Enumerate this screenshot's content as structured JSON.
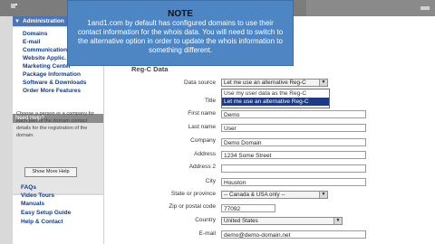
{
  "sidebar": {
    "section_title": "Administration",
    "items": [
      "Domains",
      "E-mail",
      "Communication",
      "Website Applic.",
      "Marketing Center",
      "Package Information",
      "Software & Downloads",
      "Order More Features"
    ],
    "help_title": "Need Help?",
    "help_text": "Choose a person or a company for each part of the domain contact details for the registration of the domain.",
    "help_button": "Show More Help",
    "links": [
      "FAQs",
      "Video Tours",
      "Manuals",
      "Easy Setup Guide",
      "Help & Contact"
    ]
  },
  "form": {
    "section_title": "Reg-C Data",
    "data_source_label": "Data source",
    "data_source_value": "Let me use an alternative Reg-C",
    "dropdown_options": [
      "Use my user data as the Reg-C",
      "Let me use an alternative Reg-C"
    ],
    "title_label": "Title",
    "first_name_label": "First name",
    "first_name_value": "Demo",
    "last_name_label": "Last name",
    "last_name_value": "User",
    "company_label": "Company",
    "company_value": "Demo Domain",
    "address_label": "Address",
    "address_value": "1234 Some Street",
    "address2_label": "Address 2",
    "address2_value": "",
    "city_label": "City",
    "city_value": "Houston",
    "state_label": "State or province",
    "state_value": "-- Canada & USA only --",
    "zip_label": "Zip or postal code",
    "zip_value": "77092",
    "country_label": "Country",
    "country_value": "United States",
    "email_label": "E-mail",
    "email_value": "demo@demo-domain.net"
  },
  "note": {
    "title": "NOTE",
    "body": "1and1.com by default has configured domains to use their contact information for the whois data. You will need to switch to the alternative option in order to update the whois information to something different."
  }
}
